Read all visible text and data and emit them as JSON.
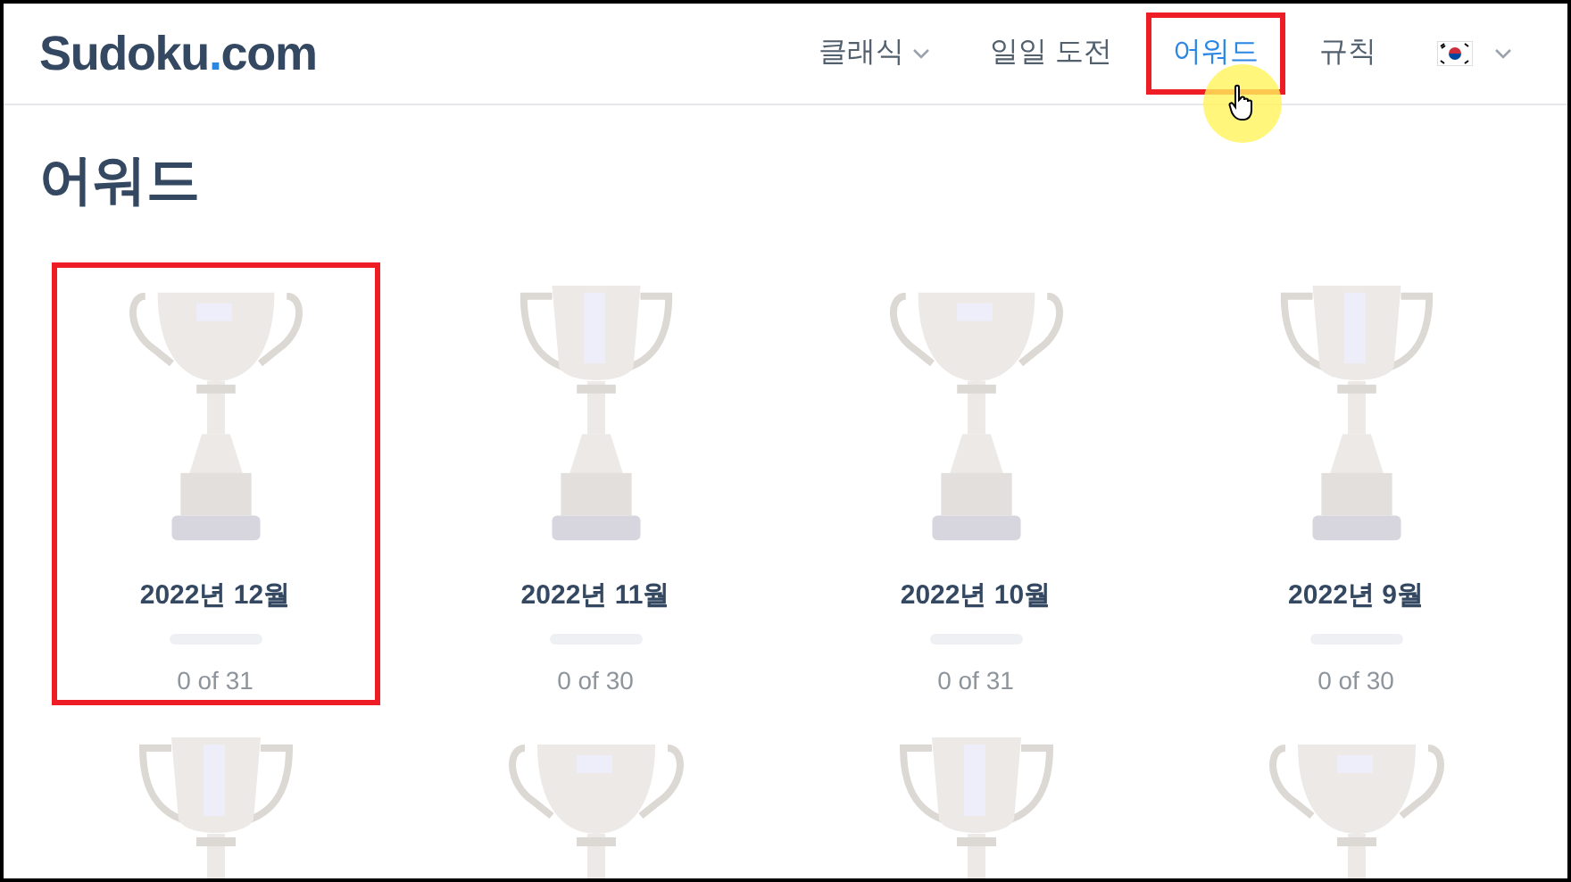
{
  "header": {
    "logo": {
      "name": "Sudoku",
      "dot": ".",
      "suffix": "com"
    },
    "nav": [
      {
        "kind": "dropdown",
        "label": "클래식",
        "selected": false,
        "highlighted": false
      },
      {
        "kind": "link",
        "label": "일일 도전",
        "selected": false,
        "highlighted": false
      },
      {
        "kind": "link",
        "label": "어워드",
        "selected": true,
        "highlighted": true
      },
      {
        "kind": "link",
        "label": "규칙",
        "selected": false,
        "highlighted": false
      },
      {
        "kind": "language",
        "selected": false,
        "highlighted": false
      }
    ]
  },
  "page_title": "어워드",
  "awards": [
    {
      "title": "2022년 12월",
      "count": "0 of 31",
      "level": 0,
      "highlighted": true
    },
    {
      "title": "2022년 11월",
      "count": "0 of 30",
      "level": 0,
      "highlighted": false
    },
    {
      "title": "2022년 10월",
      "count": "0 of 31",
      "level": 0,
      "highlighted": false
    },
    {
      "title": "2022년 9월",
      "count": "0 of 30",
      "level": 0,
      "highlighted": false
    }
  ]
}
